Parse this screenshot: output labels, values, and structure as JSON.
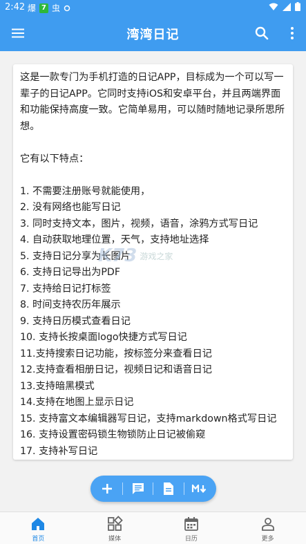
{
  "status_bar": {
    "time": "2:42",
    "icon_text_1": "爆",
    "icon_badge": "7",
    "icon_text_2": "虫"
  },
  "app_bar": {
    "title": "湾湾日记",
    "menu_icon": "hamburger-menu-icon",
    "search_icon": "search-icon",
    "more_icon": "more-vert-icon"
  },
  "card": {
    "intro": "这是一款专门为手机打造的日记APP，目标成为一个可以写一辈子的日记APP。它同时支持iOS和安卓平台，并且两端界面和功能保持高度一致。它简单易用，可以随时随地记录所思所想。",
    "features_heading": "它有以下特点：",
    "features": [
      "1. 不需要注册账号就能使用，",
      "2. 没有网络也能写日记",
      "3. 同时支持文本，图片，视频，语音，涂鸦方式写日记",
      "4. 自动获取地理位置，天气，支持地址选择",
      "5.  支持日记分享为长图片",
      "6.  支持日记导出为PDF",
      "7. 支持给日记打标签",
      "8. 时间支持农历年展示",
      "9. 支持日历模式查看日记",
      "10. 支持长按桌面logo快捷方式写日记",
      "11.支持搜索日记功能，按标签分来查看日记",
      "12.支持查看相册日记，视频日记和语音日记",
      "13.支持暗黑模式",
      "14.支持在地图上显示日记",
      "15. 支持富文本编辑器写日记，支持markdown格式写日记",
      "16. 支持设置密码锁生物锁防止日记被偷窥",
      "17. 支持补写日记"
    ]
  },
  "watermark": {
    "logo": "K73",
    "text": "游戏之家"
  },
  "fab": {
    "add_icon": "plus-icon",
    "chat_icon": "message-icon",
    "doc_icon": "document-icon",
    "md_icon": "markdown-icon"
  },
  "bottom_nav": {
    "items": [
      {
        "label": "首页",
        "icon": "home-icon",
        "active": true
      },
      {
        "label": "媒体",
        "icon": "grid-icon",
        "active": false
      },
      {
        "label": "日历",
        "icon": "calendar-icon",
        "active": false
      },
      {
        "label": "更多",
        "icon": "person-icon",
        "active": false
      }
    ]
  },
  "colors": {
    "primary": "#3f9cf0",
    "fab": "#4aa3f4",
    "active_nav": "#1e88e5"
  }
}
